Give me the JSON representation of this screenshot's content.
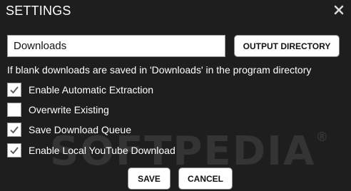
{
  "dialog": {
    "title": "SETTINGS",
    "close_icon": "close-icon"
  },
  "directory": {
    "value": "Downloads",
    "button_label": "OUTPUT DIRECTORY"
  },
  "hint": "If blank downloads are saved in 'Downloads' in the program directory",
  "options": [
    {
      "label": "Enable Automatic Extraction",
      "checked": true
    },
    {
      "label": "Overwrite Existing",
      "checked": false
    },
    {
      "label": "Save Download Queue",
      "checked": true
    },
    {
      "label": "Enable Local YouTube Download",
      "checked": true
    }
  ],
  "footer": {
    "save_label": "SAVE",
    "cancel_label": "CANCEL"
  },
  "watermark": {
    "text": "SOFTPEDIA",
    "mark": "®"
  },
  "colors": {
    "background": "#1e1e1e",
    "text": "#ffffff",
    "button_bg": "#ffffff",
    "button_text": "#111111",
    "check": "#555555"
  }
}
